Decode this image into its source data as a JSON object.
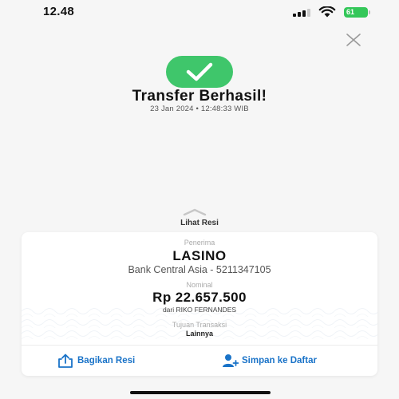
{
  "status_bar": {
    "time": "12.48",
    "battery": "61"
  },
  "colors": {
    "success": "#3fc66b",
    "link": "#1a73c8",
    "battery": "#34c759"
  },
  "header": {
    "close_icon": "close-icon",
    "success_icon": "check-icon",
    "title": "Transfer Berhasil!",
    "datetime": "23 Jan 2024 • 12:48:33 WIB"
  },
  "receipt_toggle": {
    "icon": "chevron-up-icon",
    "label": "Lihat Resi"
  },
  "receipt": {
    "recipient_label": "Penerima",
    "recipient_name": "LASINO",
    "bank_account": "Bank Central Asia - 5211347105",
    "amount_label": "Nominal",
    "amount": "Rp 22.657.500",
    "sender": "dari RIKO FERNANDES",
    "purpose_label": "Tujuan Transaksi",
    "purpose": "Lainnya"
  },
  "actions": {
    "share_label": "Bagikan Resi",
    "share_icon": "share-icon",
    "save_label": "Simpan ke Daftar",
    "save_icon": "add-contact-icon"
  }
}
